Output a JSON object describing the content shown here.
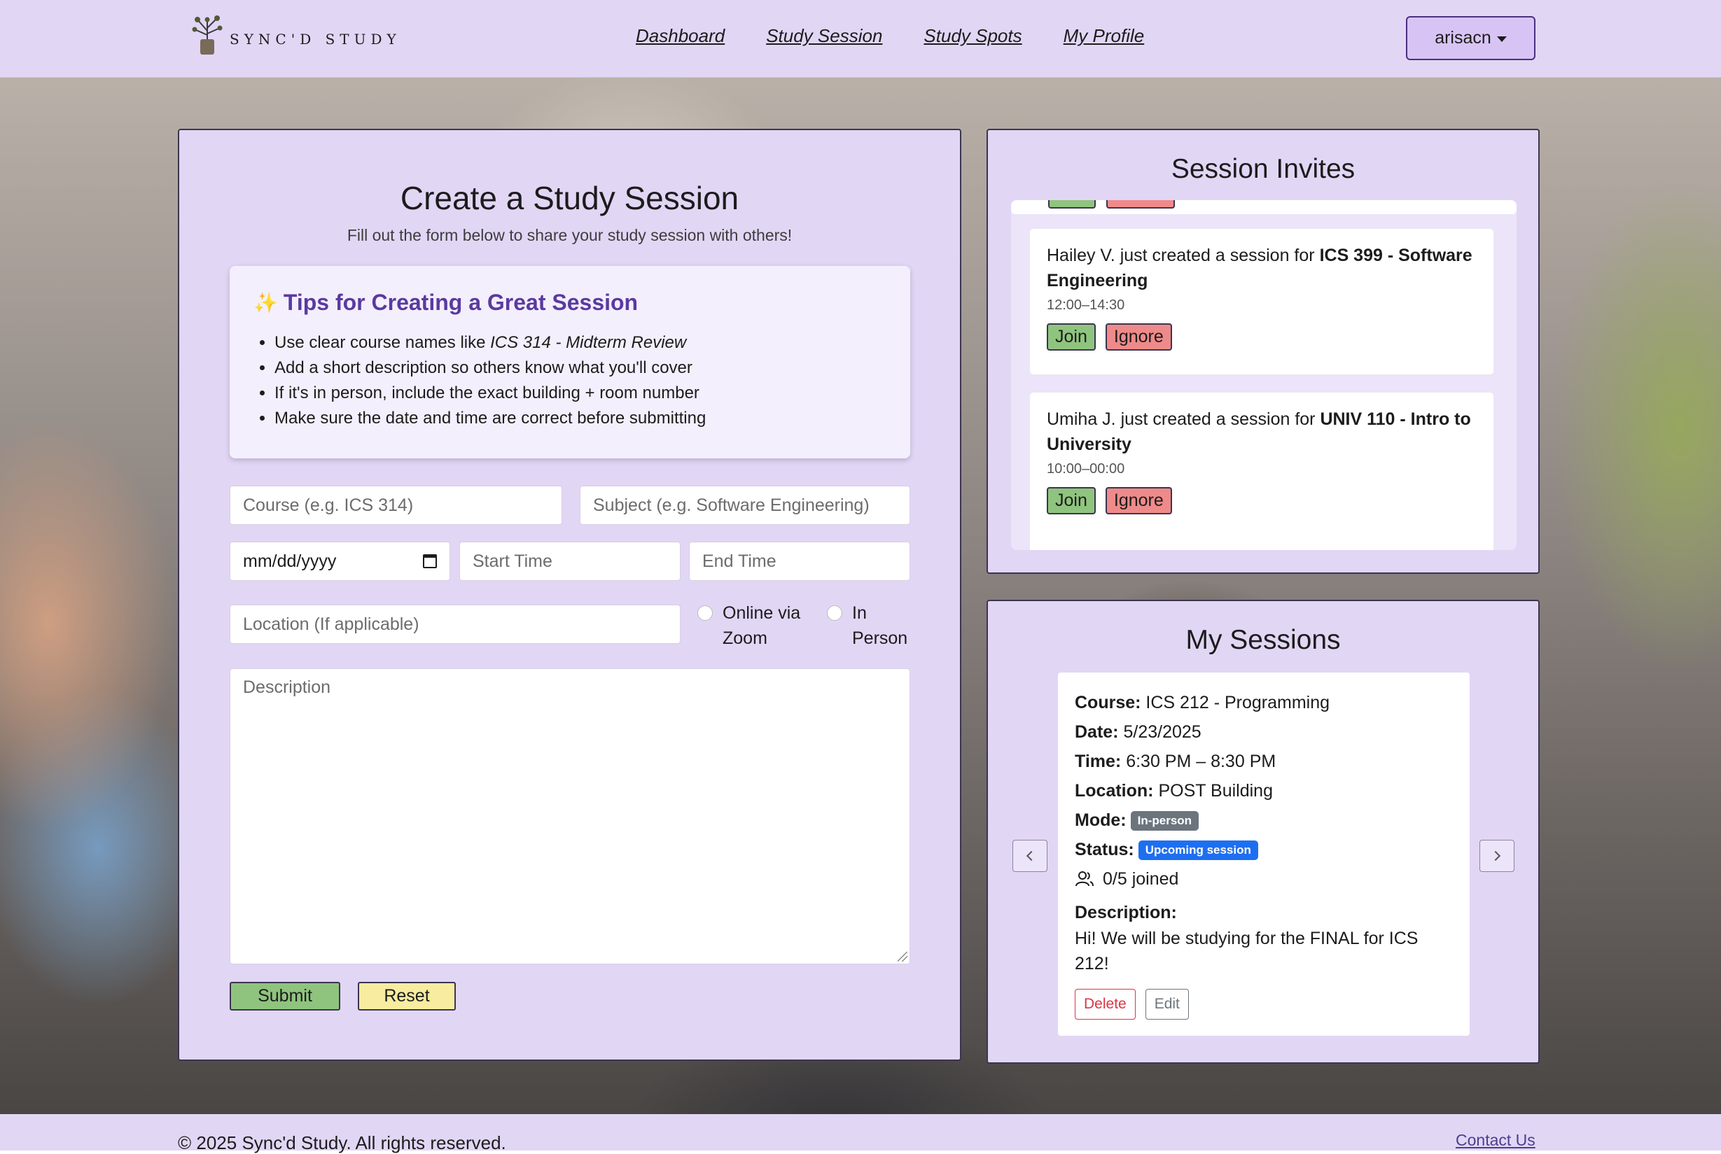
{
  "nav": {
    "brand": "SYNC'D STUDY",
    "links": [
      "Dashboard",
      "Study Session",
      "Study Spots",
      "My Profile"
    ],
    "user": "arisacn"
  },
  "create": {
    "title": "Create a Study Session",
    "subtitle": "Fill out the form below to share your study session with others!",
    "tips_title": "Tips for Creating a Great Session",
    "tips": {
      "t1_prefix": "Use clear course names like ",
      "t1_example": "ICS 314 - Midterm Review",
      "t2": "Add a short description so others know what you'll cover",
      "t3": "If it's in person, include the exact building + room number",
      "t4": "Make sure the date and time are correct before submitting"
    },
    "placeholders": {
      "course": "Course (e.g. ICS 314)",
      "subject": "Subject (e.g. Software Engineering)",
      "date": "mm/dd/yyyy",
      "start": "Start Time",
      "end": "End Time",
      "location": "Location (If applicable)",
      "description": "Description"
    },
    "radio_online": "Online via Zoom",
    "radio_inperson": "In Person",
    "submit": "Submit",
    "reset": "Reset"
  },
  "invites": {
    "title": "Session Invites",
    "items": [
      {
        "prefix": "Hailey V. just created a session for ",
        "course": "ICS 399 - Software Engineering",
        "time": "12:00–14:30",
        "join": "Join",
        "ignore": "Ignore"
      },
      {
        "prefix": "Umiha J. just created a session for ",
        "course": "UNIV 110 - Intro to University",
        "time": "10:00–00:00",
        "join": "Join",
        "ignore": "Ignore"
      }
    ]
  },
  "sessions": {
    "title": "My Sessions",
    "labels": {
      "course": "Course:",
      "date": "Date:",
      "time": "Time:",
      "location": "Location:",
      "mode": "Mode:",
      "status": "Status:",
      "description": "Description:"
    },
    "card": {
      "course": "ICS 212 - Programming",
      "date": "5/23/2025",
      "time": "6:30 PM – 8:30 PM",
      "location": "POST Building",
      "mode": "In-person",
      "status": "Upcoming session",
      "joined": "0/5 joined",
      "description": "Hi! We will be studying for the FINAL for ICS 212!",
      "delete": "Delete",
      "edit": "Edit"
    }
  },
  "footer": {
    "copyright": "© 2025 Sync'd Study. All rights reserved.",
    "contact": "Contact Us"
  },
  "colors": {
    "panel": "#e2d6f5",
    "accent": "#5a3aa0",
    "join": "#8fc47e",
    "ignore": "#ef8a8a",
    "reset": "#f7ec9f",
    "status_badge": "#1e6ff0",
    "mode_badge": "#6c757d"
  }
}
